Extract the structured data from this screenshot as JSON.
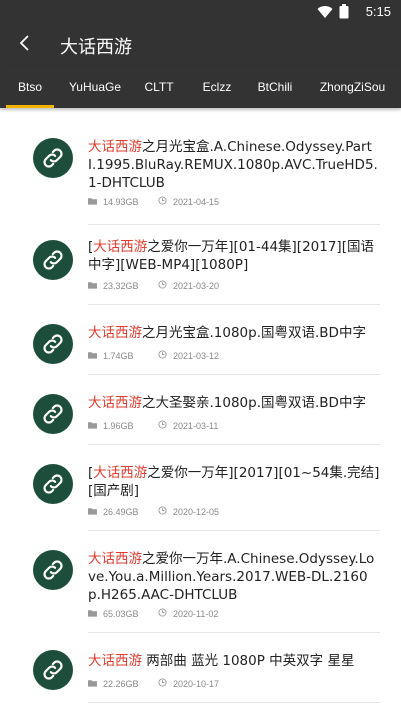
{
  "status": {
    "time": "5:15"
  },
  "header": {
    "title": "大话西游"
  },
  "tabs": [
    "Btso",
    "YuHuaGe",
    "CLTT",
    "Eclzz",
    "BtChili",
    "ZhongZiSou"
  ],
  "active_tab": "Btso",
  "colors": {
    "accent": "#f0b400",
    "highlight": "#e23b2e",
    "avatar": "#1c4e3b",
    "bar": "#333333"
  },
  "results": [
    {
      "prefix": "",
      "highlight": "大话西游",
      "rest": "之月光宝盒.A.Chinese.Odyssey.PartI.1995.BluRay.REMUX.1080p.AVC.TrueHD5.1-DHTCLUB",
      "size": "14.93GB",
      "date": "2021-04-15"
    },
    {
      "prefix": "[",
      "highlight": "大话西游",
      "rest": "之爱你一万年][01-44集][2017][国语中字][WEB-MP4][1080P]",
      "size": "23.32GB",
      "date": "2021-03-20"
    },
    {
      "prefix": "",
      "highlight": "大话西游",
      "rest": "之月光宝盒.1080p.国粤双语.BD中字",
      "size": "1.74GB",
      "date": "2021-03-12"
    },
    {
      "prefix": "",
      "highlight": "大话西游",
      "rest": "之大圣娶亲.1080p.国粤双语.BD中字",
      "size": "1.96GB",
      "date": "2021-03-11"
    },
    {
      "prefix": "[",
      "highlight": "大话西游",
      "rest": "之爱你一万年][2017][01~54集.完结][国产剧]",
      "size": "26.49GB",
      "date": "2020-12-05"
    },
    {
      "prefix": "",
      "highlight": "大话西游",
      "rest": "之爱你一万年.A.Chinese.Odyssey.Love.You.a.Million.Years.2017.WEB-DL.2160p.H265.AAC-DHTCLUB",
      "size": "65.03GB",
      "date": "2020-11-02"
    },
    {
      "prefix": "",
      "highlight": "大话西游",
      "rest": " 两部曲 蓝光 1080P 中英双字 星星",
      "size": "22.26GB",
      "date": "2020-10-17"
    }
  ]
}
